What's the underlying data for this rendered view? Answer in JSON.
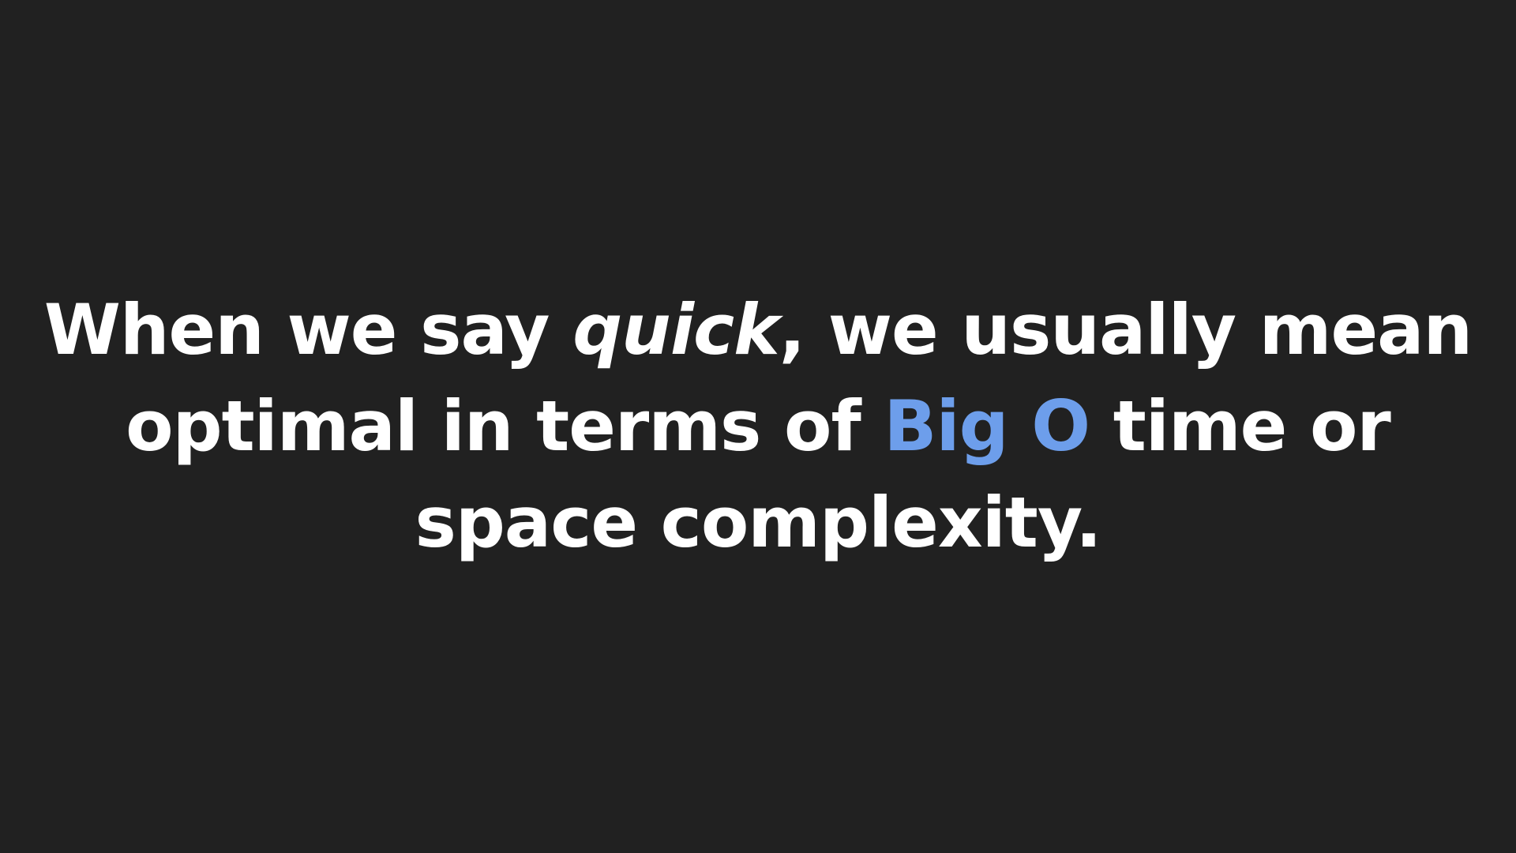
{
  "slide": {
    "background_color": "#212121",
    "text_color": "#ffffff",
    "highlight_color": "#6d9eeb",
    "line1": {
      "lead": "When we say ",
      "emphasis": "quick",
      "tail": ", we usually mean"
    },
    "line2": {
      "lead": "optimal in terms of ",
      "highlight": "Big O",
      "tail": " time or"
    },
    "line3": {
      "text": "space complexity."
    }
  }
}
